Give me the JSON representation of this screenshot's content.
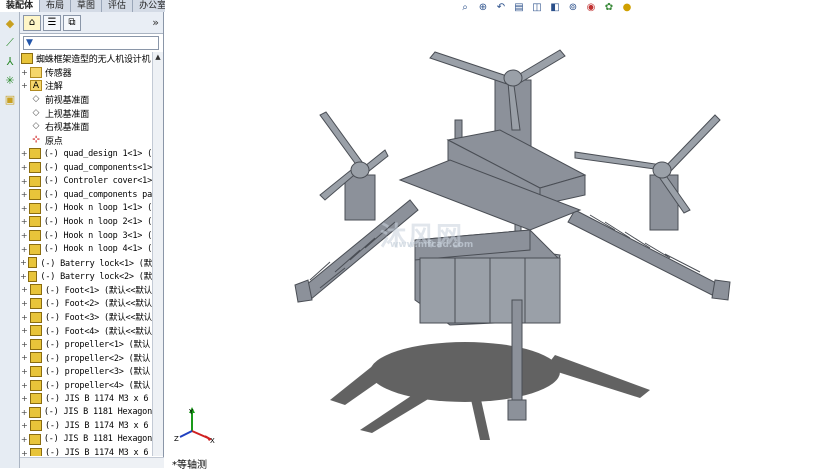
{
  "command_tabs": [
    "装配体",
    "布局",
    "草图",
    "评估",
    "办公室产品"
  ],
  "left_icons": [
    "smart-mates-icon",
    "sketch-icon",
    "mate-icon",
    "explode-icon",
    "appearance-icon"
  ],
  "panel_tabs": [
    "featuremanager-icon",
    "propertymanager-icon",
    "configurationmanager-icon"
  ],
  "expand_chevron": "»",
  "filter_symbol": "▼",
  "tree": {
    "top_label": "蜘蛛框架造型的无人机设计机",
    "items": [
      {
        "label": "传感器",
        "icon": "folder",
        "cn": true
      },
      {
        "label": "注解",
        "icon": "folder",
        "cn": true
      },
      {
        "label": "前视基准面",
        "icon": "plane",
        "cn": true
      },
      {
        "label": "上视基准面",
        "icon": "plane",
        "cn": true
      },
      {
        "label": "右视基准面",
        "icon": "plane",
        "cn": true
      },
      {
        "label": "原点",
        "icon": "origin",
        "cn": true
      },
      {
        "label": "(-) quad_design 1<1> (",
        "icon": "part"
      },
      {
        "label": "(-) quad_components<1>",
        "icon": "part"
      },
      {
        "label": "(-) Controler cover<1>",
        "icon": "part"
      },
      {
        "label": "(-) quad_components pa",
        "icon": "part"
      },
      {
        "label": "(-) Hook n loop 1<1> (",
        "icon": "part"
      },
      {
        "label": "(-) Hook n loop 2<1> (",
        "icon": "part"
      },
      {
        "label": "(-) Hook n loop 3<1> (",
        "icon": "part"
      },
      {
        "label": "(-) Hook n loop 4<1> (",
        "icon": "part"
      },
      {
        "label": "(-) Baterry lock<1> (默",
        "icon": "part"
      },
      {
        "label": "(-) Baterry lock<2> (默",
        "icon": "part"
      },
      {
        "label": "(-) Foot<1> (默认<<默认",
        "icon": "part"
      },
      {
        "label": "(-) Foot<2> (默认<<默认",
        "icon": "part"
      },
      {
        "label": "(-) Foot<3> (默认<<默认",
        "icon": "part"
      },
      {
        "label": "(-) Foot<4> (默认<<默认",
        "icon": "part"
      },
      {
        "label": "(-) propeller<1> (默认",
        "icon": "part"
      },
      {
        "label": "(-) propeller<2> (默认",
        "icon": "part"
      },
      {
        "label": "(-) propeller<3> (默认",
        "icon": "part"
      },
      {
        "label": "(-) propeller<4> (默认",
        "icon": "part"
      },
      {
        "label": "(-) JIS B 1174 M3 x 6",
        "icon": "part"
      },
      {
        "label": "(-) JIS B 1181 Hexagon",
        "icon": "part"
      },
      {
        "label": "(-) JIS B 1174 M3 x 6",
        "icon": "part"
      },
      {
        "label": "(-) JIS B 1181 Hexagon",
        "icon": "part"
      },
      {
        "label": "(-) JIS B 1174 M3 x 6",
        "icon": "part"
      }
    ]
  },
  "view_toolbar": [
    "zoom-to-fit-icon",
    "zoom-area-icon",
    "previous-view-icon",
    "section-view-icon",
    "view-orientation-icon",
    "display-style-icon",
    "hide-show-icon",
    "edit-appearance-icon",
    "apply-scene-icon",
    "view-settings-icon"
  ],
  "triad": {
    "x": "X",
    "y": "Y",
    "z": "Z"
  },
  "view_name": "*等轴测",
  "watermark": {
    "text": "沐风网",
    "sub": "www.mfcad.com"
  },
  "colors": {
    "model": "#8c919a",
    "model_dark": "#4a4e55",
    "shadow": "#3c3c3c"
  }
}
